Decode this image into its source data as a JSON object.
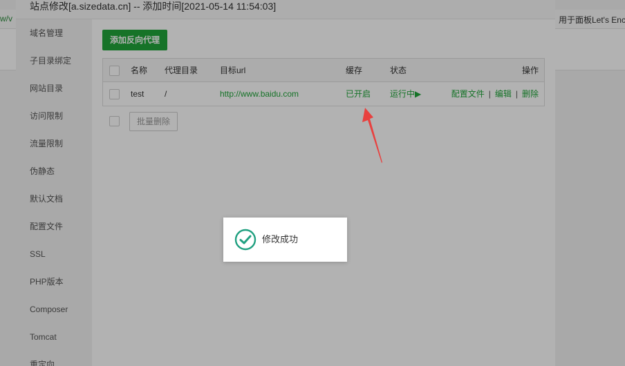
{
  "background": {
    "left_text": "w/v",
    "right_text": "用于面板Let's Enc"
  },
  "dialog": {
    "title": "站点修改[a.sizedata.cn] -- 添加时间[2021-05-14 11:54:03]"
  },
  "sidebar": {
    "items": [
      {
        "label": "域名管理"
      },
      {
        "label": "子目录绑定"
      },
      {
        "label": "网站目录"
      },
      {
        "label": "访问限制"
      },
      {
        "label": "流量限制"
      },
      {
        "label": "伪静态"
      },
      {
        "label": "默认文档"
      },
      {
        "label": "配置文件"
      },
      {
        "label": "SSL"
      },
      {
        "label": "PHP版本"
      },
      {
        "label": "Composer"
      },
      {
        "label": "Tomcat"
      },
      {
        "label": "重定向"
      }
    ]
  },
  "main": {
    "add_button": "添加反向代理",
    "table": {
      "headers": {
        "name": "名称",
        "dir": "代理目录",
        "url": "目标url",
        "cache": "缓存",
        "status": "状态",
        "action": "操作"
      },
      "rows": [
        {
          "name": "test",
          "dir": "/",
          "url": "http://www.baidu.com",
          "cache": "已开启",
          "status": "运行中▶",
          "config": "配置文件",
          "edit": "编辑",
          "delete": "删除"
        }
      ]
    },
    "batch_delete": "批量删除"
  },
  "toast": {
    "message": "修改成功"
  },
  "colors": {
    "accent": "#20a53a",
    "arrow": "#e8413f",
    "success_icon": "#20a080"
  },
  "icons": {
    "toast": "check-circle-icon",
    "annotation": "red-arrow"
  }
}
